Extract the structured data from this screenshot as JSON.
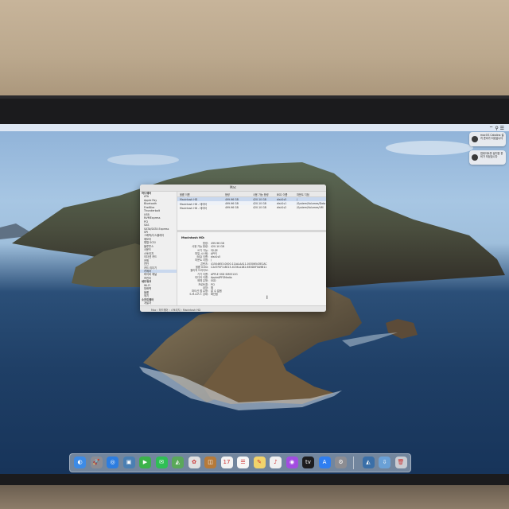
{
  "window": {
    "title": "Mac",
    "sidebar": [
      {
        "label": "하드웨어",
        "section": true
      },
      {
        "label": "ATA"
      },
      {
        "label": "Apple Pay"
      },
      {
        "label": "Bluetooth"
      },
      {
        "label": "FireWire"
      },
      {
        "label": "Thunderbolt"
      },
      {
        "label": "USB"
      },
      {
        "label": "NVMExpress"
      },
      {
        "label": "PCI"
      },
      {
        "label": "SAS"
      },
      {
        "label": "SATA/SATA Express"
      },
      {
        "label": "SPI"
      },
      {
        "label": "그래픽/디스플레이"
      },
      {
        "label": "메모리"
      },
      {
        "label": "병렬 SCSI"
      },
      {
        "label": "블루투스"
      },
      {
        "label": "사운드"
      },
      {
        "label": "스토리지"
      },
      {
        "label": "이더넷 카드"
      },
      {
        "label": "전원"
      },
      {
        "label": "진단"
      },
      {
        "label": "카드 리더기"
      },
      {
        "label": "카메라",
        "selected": true
      },
      {
        "label": "파이버 채널"
      },
      {
        "label": "프린터"
      },
      {
        "label": "네트워크",
        "section": true
      },
      {
        "label": "Wi-Fi"
      },
      {
        "label": "방화벽"
      },
      {
        "label": "볼륨"
      },
      {
        "label": "위치"
      },
      {
        "label": "소프트웨어",
        "section": true
      },
      {
        "label": "개발자"
      },
      {
        "label": "관리형 클라이언트"
      }
    ],
    "table": {
      "headers": [
        "볼륨 이름",
        "용량",
        "사용 가능 용량",
        "BSD 이름",
        "마운트 지점"
      ],
      "rows": [
        [
          "Macintosh HD",
          "499.96 GB",
          "420.10 GB",
          "disk1s5",
          "/"
        ],
        [
          "Macintosh HD - 데이터",
          "499.96 GB",
          "420.10 GB",
          "disk1s1",
          "/System/Volumes/Data"
        ],
        [
          "Macintosh HD - 데이터",
          "499.96 GB",
          "420.10 GB",
          "disk1s2",
          "/System/Volumes/VM"
        ]
      ]
    },
    "details": {
      "title": "Macintosh HD:",
      "rows": [
        {
          "k": "용량:",
          "v": "499.96 GB"
        },
        {
          "k": "사용 가능 용량:",
          "v": "420.10 GB"
        },
        {
          "k": "쓰기 가능:",
          "v": "아니요"
        },
        {
          "k": "파일 시스템:",
          "v": "APFS"
        },
        {
          "k": "BSD 이름:",
          "v": "disk1s5"
        },
        {
          "k": "마운트 지점:",
          "v": "/"
        },
        {
          "k": "콘텐츠:",
          "v": "41504653-0000-11AA-AA11-00306543ECAC"
        },
        {
          "k": "볼륨 UUID:",
          "v": "C2A7F0F3-8E23-4C56-A1B2-6E0D0F0A9B11"
        },
        {
          "k": "물리적 드라이브:",
          "v": ""
        },
        {
          "k": "기기 이름:",
          "v": "APPLE SSD SM0512G"
        },
        {
          "k": "미디어 이름:",
          "v": "AppleAPFSMedia"
        },
        {
          "k": "매체 유형:",
          "v": "SSD"
        },
        {
          "k": "프로토콜:",
          "v": "PCI"
        },
        {
          "k": "내장:",
          "v": "예"
        },
        {
          "k": "파티션 맵 유형:",
          "v": "알 수 없음"
        },
        {
          "k": "S.M.A.R.T. 상태:",
          "v": "확인됨"
        }
      ]
    },
    "statusbar": "Mac › 하드웨어 › 스토리지 › Macintosh HD"
  },
  "notifications": [
    {
      "text": "macOS Catalina 설치 준비가 되었습니다"
    },
    {
      "text": "업데이트를 설치할 준비가 되었습니다"
    }
  ],
  "menubar_icons": "⌔ ⚲ ☰",
  "dock": [
    {
      "icon": "finder-icon",
      "glyph": "◐",
      "color": "#3d8be6"
    },
    {
      "icon": "launchpad-icon",
      "glyph": "🚀",
      "color": "#8c8c93"
    },
    {
      "icon": "safari-icon",
      "glyph": "◎",
      "color": "#2d7de0"
    },
    {
      "icon": "photos-app-icon",
      "glyph": "▣",
      "color": "#4a7fb3"
    },
    {
      "icon": "facetime-icon",
      "glyph": "▶",
      "color": "#3cb24a"
    },
    {
      "icon": "messages-icon",
      "glyph": "✉",
      "color": "#2fbf55"
    },
    {
      "icon": "maps-icon",
      "glyph": "◭",
      "color": "#5aa85a"
    },
    {
      "icon": "photos-icon",
      "glyph": "✿",
      "color": "#e0e0e0"
    },
    {
      "icon": "contacts-icon",
      "glyph": "◫",
      "color": "#b57a3a"
    },
    {
      "icon": "calendar-icon",
      "glyph": "17",
      "color": "#f3f3f3"
    },
    {
      "icon": "reminders-icon",
      "glyph": "☰",
      "color": "#f6f6f6"
    },
    {
      "icon": "notes-icon",
      "glyph": "✎",
      "color": "#f2d36b"
    },
    {
      "icon": "music-icon",
      "glyph": "♪",
      "color": "#f0f0f0"
    },
    {
      "icon": "podcasts-icon",
      "glyph": "◉",
      "color": "#a24de0"
    },
    {
      "icon": "tv-icon",
      "glyph": "tv",
      "color": "#1c1c1e"
    },
    {
      "icon": "app-store-icon",
      "glyph": "A",
      "color": "#2f7ef0"
    },
    {
      "icon": "system-preferences-icon",
      "glyph": "⚙",
      "color": "#8d8d92"
    },
    {
      "icon": "separator"
    },
    {
      "icon": "airdrop-icon",
      "glyph": "◭",
      "color": "#3a6fa8"
    },
    {
      "icon": "downloads-icon",
      "glyph": "⇩",
      "color": "#6aa0d6"
    },
    {
      "icon": "trash-icon",
      "glyph": "🗑",
      "color": "#c9ccd2"
    }
  ],
  "colors": {
    "light_red": "#fc5f57",
    "light_yellow": "#fdbc2e",
    "light_green": "#28c840",
    "selection": "#c9d8ee"
  }
}
